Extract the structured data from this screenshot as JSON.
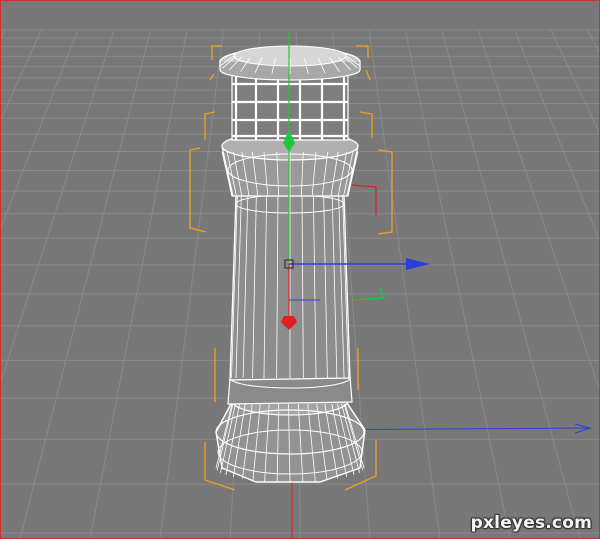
{
  "watermark": {
    "text": "pxleyes.com"
  },
  "colors": {
    "background": "#787878",
    "grid": "#8a8a8a",
    "model": "#ffffff",
    "model_shade": "#9a9a9a",
    "bounding_box": "#f0a020",
    "axis_x": "#2b3fd6",
    "axis_y": "#1ec83a",
    "axis_z": "#e02020",
    "frame": "#c9322e"
  },
  "icons": {
    "gizmo": "move-gizmo-icon",
    "world_axis": "world-axis-icon",
    "object": "lighthouse-model"
  }
}
